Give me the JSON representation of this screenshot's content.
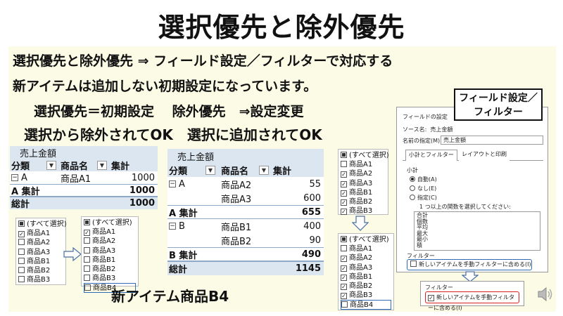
{
  "slide": {
    "title": "選択優先と除外優先",
    "lines": [
      "選択優先と除外優先 ⇒ フィールド設定／フィルターで対応する",
      "新アイテムは追加しない初期設定になっています。",
      "選択優先＝初期設定　 除外優先　⇒設定変更",
      "選択から除外されてOK　選択に追加されてOK"
    ],
    "new_item_label": "新アイテム商品B4",
    "callout": [
      "フィールド設定／",
      "フィルター"
    ]
  },
  "pivot1": {
    "measure": "売上金額",
    "headers": [
      "分類",
      "商品名",
      "集計"
    ],
    "rows": [
      {
        "group": "A",
        "item": "商品A1",
        "value": "1000"
      },
      {
        "subtotal": "A 集計",
        "value": "1000"
      },
      {
        "total": "総計",
        "value": "1000"
      }
    ]
  },
  "pivot2": {
    "measure": "売上金額",
    "headers": [
      "分類",
      "商品名",
      "集計"
    ],
    "rows": [
      {
        "group": "A",
        "item": "商品A2",
        "value": "55"
      },
      {
        "item": "商品A3",
        "value": "600"
      },
      {
        "subtotal": "A 集計",
        "value": "655"
      },
      {
        "group": "B",
        "item": "商品B1",
        "value": "400"
      },
      {
        "item": "商品B2",
        "value": "90"
      },
      {
        "subtotal": "B 集計",
        "value": "490"
      },
      {
        "total": "総計",
        "value": "1145"
      }
    ]
  },
  "filter_lists": {
    "f1": [
      "(すべて選択)",
      "商品A1",
      "商品A2",
      "商品A3",
      "商品B1",
      "商品B2",
      "商品B3"
    ],
    "f2": [
      "(すべて選択)",
      "商品A1",
      "商品A2",
      "商品A3",
      "商品B1",
      "商品B2",
      "商品B3",
      "商品B4"
    ],
    "f3": [
      "(すべて選択)",
      "商品A1",
      "商品A2",
      "商品A3",
      "商品B1",
      "商品B2",
      "商品B3"
    ],
    "f4": [
      "(すべて選択)",
      "商品A1",
      "商品A2",
      "商品A3",
      "商品B1",
      "商品B2",
      "商品B3",
      "商品B4"
    ]
  },
  "dialog": {
    "title": "フィールドの設定",
    "source_label": "ソース名:",
    "source_value": "売上金額",
    "name_label": "名前の指定(M):",
    "name_value": "売上金額",
    "tabs": [
      "小計とフィルター",
      "レイアウトと印刷"
    ],
    "subtotal_label": "小計",
    "options": [
      "自動(A)",
      "なし(E)",
      "指定(C)"
    ],
    "fn_prompt": "1 つ以上の関数を選択してください:",
    "functions": [
      "合計",
      "個数",
      "平均",
      "最大",
      "最小",
      "積"
    ],
    "filter_label": "フィルター",
    "filter_checkbox": "新しいアイテムを手動フィルターに含める(I)"
  },
  "dialog_zoom": {
    "filter_label": "フィルター",
    "filter_checkbox": "新しいアイテムを手動フィルターに含める(I)"
  },
  "colors": {
    "panel": "#fbfbe6",
    "pivot_header": "#dce6f1",
    "highlight_red": "#d91f1f",
    "highlight_blue": "#2e6db4"
  }
}
